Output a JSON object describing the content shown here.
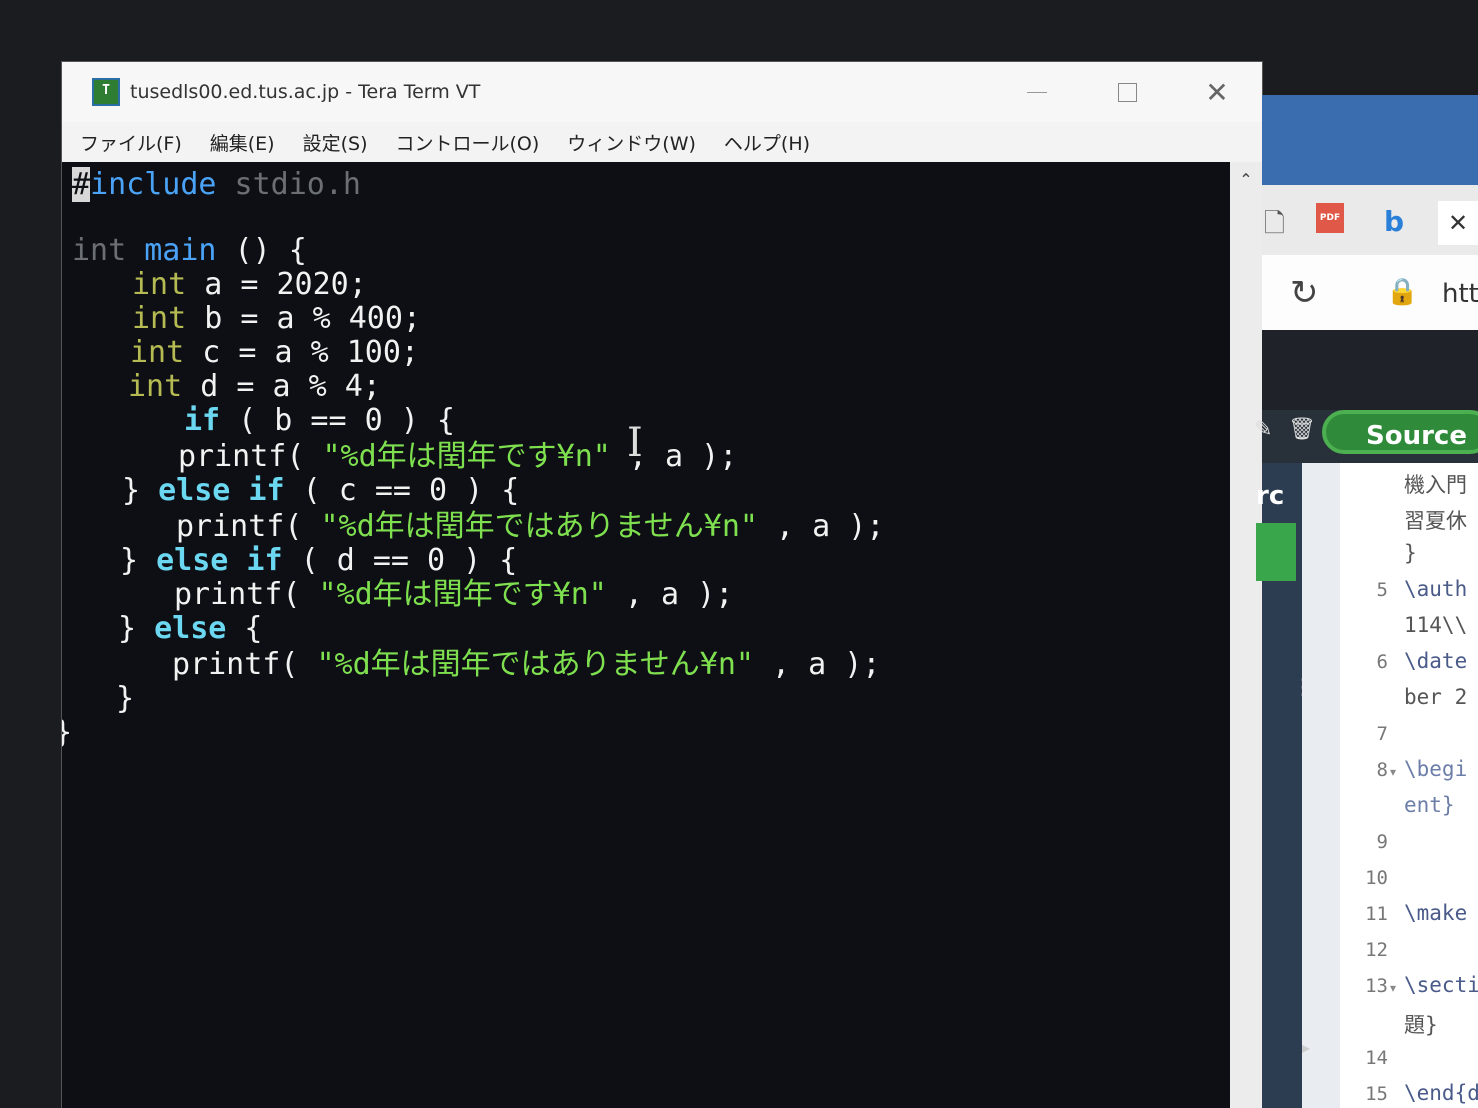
{
  "window": {
    "title": "tusedls00.ed.tus.ac.jp - Tera Term VT",
    "icon_label": "T",
    "controls": {
      "minimize": "—",
      "maximize": "☐",
      "close": "✕"
    }
  },
  "menu": [
    "ファイル(F)",
    "編集(E)",
    "設定(S)",
    "コントロール(O)",
    "ウィンドウ(W)",
    "ヘルプ(H)"
  ],
  "terminal": {
    "lines": {
      "l1_hash": "#",
      "l1_include": "include",
      "l1_rest": " stdio.h",
      "l3_int": "int",
      "l3_main": " main",
      "l3_rest": " () {",
      "l4_type": "int",
      "l4_rest": " a = 2020;",
      "l5_type": "int",
      "l5_rest": " b = a % 400;",
      "l6_type": "int",
      "l6_rest": " c = a % 100;",
      "l7_type": "int",
      "l7_rest": " d = a % 4;",
      "l8_if": "if",
      "l8_rest": " ( b == 0 ) {",
      "l9_fn": "printf( ",
      "l9_str": "\"%d年は閏年です¥n\"",
      "l9_rest": " , a );",
      "l10_brace": "} ",
      "l10_else": "else if",
      "l10_rest": " ( c == 0 ) {",
      "l11_fn": "printf( ",
      "l11_str": "\"%d年は閏年ではありません¥n\"",
      "l11_rest": " , a );",
      "l12_brace": "} ",
      "l12_else": "else if",
      "l12_rest": " ( d == 0 ) {",
      "l13_fn": "printf( ",
      "l13_str": "\"%d年は閏年です¥n\"",
      "l13_rest": " , a );",
      "l14_brace": "} ",
      "l14_else": "else",
      "l14_rest": " {",
      "l15_fn": "printf( ",
      "l15_str": "\"%d年は閏年ではありません¥n\"",
      "l15_rest": " , a );",
      "l16": "}",
      "l17": "}"
    }
  },
  "browser": {
    "url_text": "htt",
    "tab_close": "✕",
    "source_label": "Source"
  },
  "overleaf": {
    "file_label": "rc",
    "lines": [
      {
        "num": "",
        "text": "機入門"
      },
      {
        "num": "",
        "text": "習夏休"
      },
      {
        "num": "",
        "text": "}"
      },
      {
        "num": "5",
        "text": "\\auth"
      },
      {
        "num": "",
        "text": "114\\\\"
      },
      {
        "num": "6",
        "text": "\\date"
      },
      {
        "num": "",
        "text": "ber 2"
      },
      {
        "num": "7",
        "text": ""
      },
      {
        "num": "8",
        "text": "\\begi"
      },
      {
        "num": "",
        "text": "ent}"
      },
      {
        "num": "9",
        "text": ""
      },
      {
        "num": "10",
        "text": ""
      },
      {
        "num": "11",
        "text": "\\make"
      },
      {
        "num": "12",
        "text": ""
      },
      {
        "num": "13",
        "text": "\\secti"
      },
      {
        "num": "",
        "text": "題}"
      },
      {
        "num": "14",
        "text": ""
      },
      {
        "num": "15",
        "text": "\\end{d"
      }
    ]
  }
}
